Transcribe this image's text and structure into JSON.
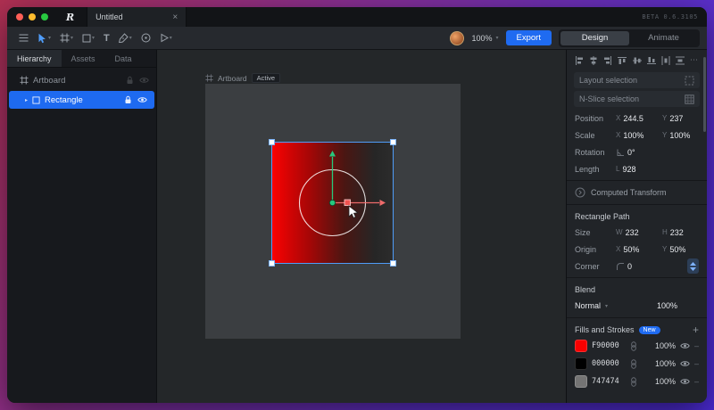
{
  "window": {
    "tab_title": "Untitled",
    "beta_label": "BETA 0.6.3105"
  },
  "icons": {
    "close": "×",
    "caret_down": "▾",
    "caret_right": "▸",
    "dots": "⋯",
    "plus": "+",
    "dash": "–",
    "text_tool": "T"
  },
  "toolbar": {
    "zoom": "100%",
    "export_label": "Export",
    "design_label": "Design",
    "animate_label": "Animate"
  },
  "sidebar": {
    "tab_hierarchy": "Hierarchy",
    "tab_assets": "Assets",
    "tab_data": "Data",
    "artboard_label": "Artboard",
    "rectangle_label": "Rectangle"
  },
  "canvas": {
    "artboard_label": "Artboard",
    "active_badge": "Active"
  },
  "inspector": {
    "layout_selection": "Layout selection",
    "nslice_selection": "N-Slice selection",
    "position_label": "Position",
    "position_x_key": "X",
    "position_x": "244.5",
    "position_y_key": "Y",
    "position_y": "237",
    "scale_label": "Scale",
    "scale_x_key": "X",
    "scale_x": "100%",
    "scale_y_key": "Y",
    "scale_y": "100%",
    "rotation_label": "Rotation",
    "rotation": "0°",
    "length_label": "Length",
    "length_key": "L",
    "length": "928",
    "computed_transform": "Computed Transform",
    "rect_path_title": "Rectangle Path",
    "size_label": "Size",
    "size_w_key": "W",
    "size_w": "232",
    "size_h_key": "H",
    "size_h": "232",
    "origin_label": "Origin",
    "origin_x_key": "X",
    "origin_x": "50%",
    "origin_y_key": "Y",
    "origin_y": "50%",
    "corner_label": "Corner",
    "corner": "0",
    "blend_title": "Blend",
    "blend_mode": "Normal",
    "blend_opacity": "100%",
    "fills_title": "Fills and Strokes",
    "new_badge": "New",
    "fills": [
      {
        "hex": "F90000",
        "color": "#F90000",
        "opacity": "100%"
      },
      {
        "hex": "000000",
        "color": "#000000",
        "opacity": "100%"
      },
      {
        "hex": "747474",
        "color": "#747474",
        "opacity": "100%"
      }
    ]
  },
  "colors": {
    "accent_blue": "#1f6bf1",
    "selection_blue": "#4f9cf8",
    "gradient_start": "#F90000",
    "gradient_end": "#000000"
  }
}
